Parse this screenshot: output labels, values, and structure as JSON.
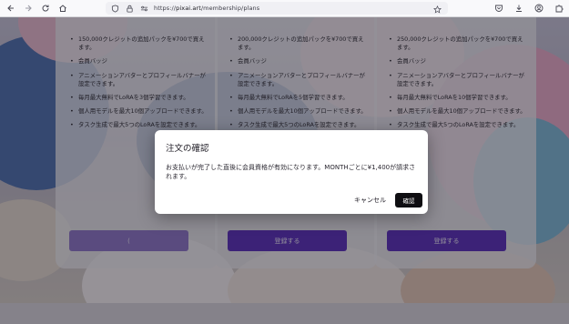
{
  "browser": {
    "url_prefix": "https://",
    "url_host": "pixai.art",
    "url_path": "/membership/plans",
    "icons": [
      "back-icon",
      "forward-icon",
      "reload-icon",
      "home-icon",
      "shield-icon",
      "lock-icon",
      "permissions-icon",
      "bookmark-star-icon",
      "pocket-icon",
      "downloads-icon",
      "account-icon",
      "extensions-icon"
    ]
  },
  "plans": [
    {
      "features": [
        "150,000クレジットの追加パックを¥700で買えます。",
        "会員バッジ",
        "アニメーションアバターとプロフィールバナーが設定できます。",
        "毎月最大無料でLoRAを3個学習できます。",
        "個人用モデルを最大10個アップロードできます。",
        "タスク生成で最大5つのLoRAを設定できます。"
      ],
      "cta": "("
    },
    {
      "features": [
        "200,000クレジットの追加パックを¥700で買えます。",
        "会員バッジ",
        "アニメーションアバターとプロフィールバナーが設定できます。",
        "毎月最大無料でLoRAを5個学習できます。",
        "個人用モデルを最大10個アップロードできます。",
        "タスク生成で最大5つのLoRAを設定できます。"
      ],
      "cta": "登録する"
    },
    {
      "features": [
        "250,000クレジットの追加パックを¥700で買えます。",
        "会員バッジ",
        "アニメーションアバターとプロフィールバナーが設定できます。",
        "毎月最大無料でLoRAを10個学習できます。",
        "個人用モデルを最大10個アップロードできます。",
        "タスク生成で最大5つのLoRAを設定できます。"
      ],
      "cta": "登録する"
    }
  ],
  "modal": {
    "title": "注文の確認",
    "body": "お支払いが完了した直後に会員資格が有効になります。MONTHごとに¥1,400が請求されます。",
    "cancel": "キャンセル",
    "confirm": "確認"
  },
  "colors": {
    "accent": "#5b2dbb",
    "accent_disabled": "#8d74c9",
    "modal_confirm": "#0f0e12"
  }
}
